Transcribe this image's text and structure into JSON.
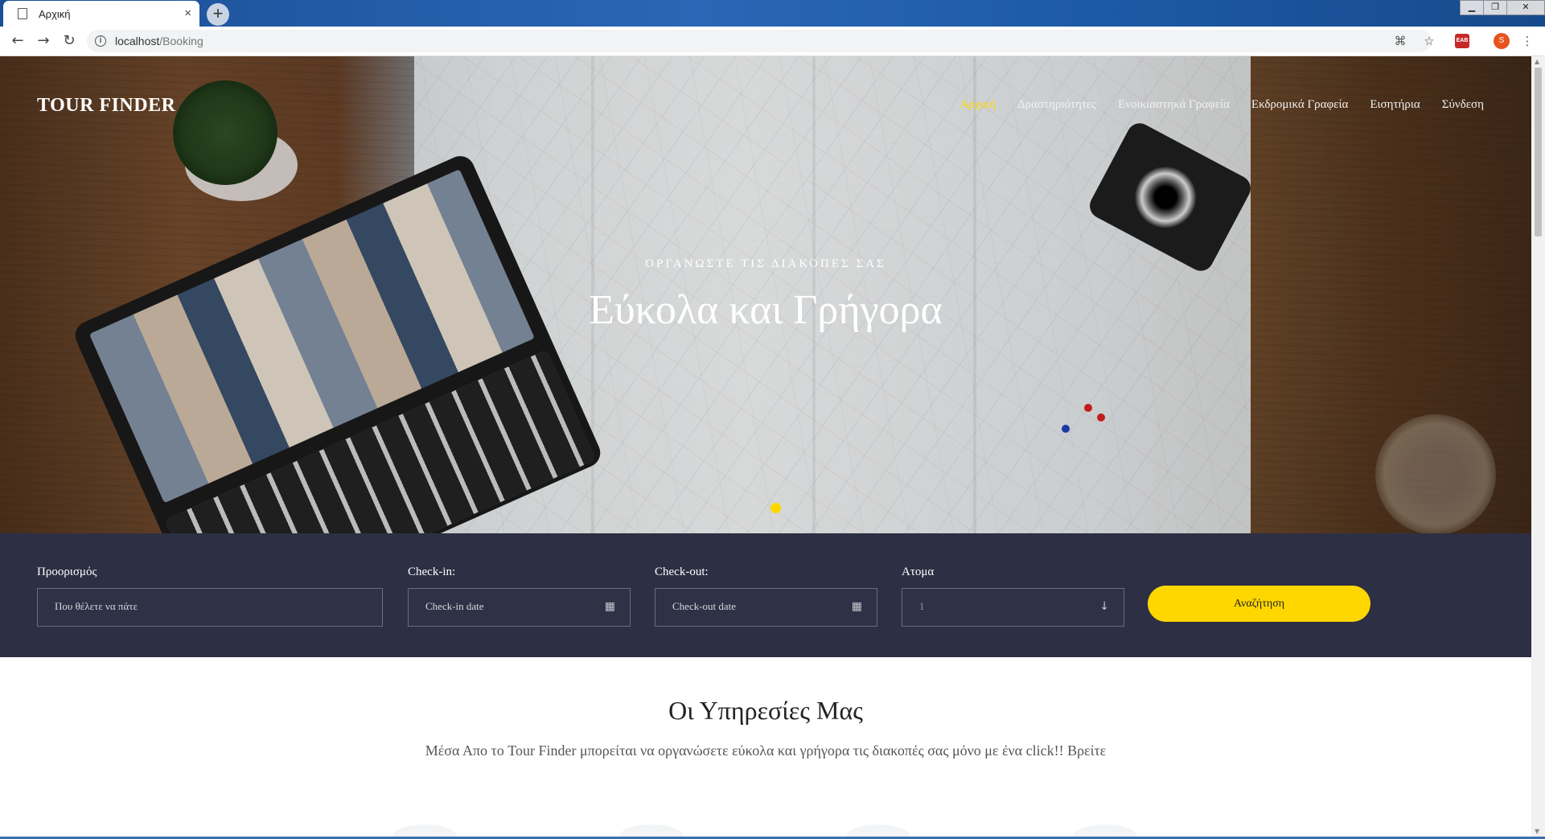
{
  "browser": {
    "tab_title": "Αρχική",
    "tab_close": "×",
    "new_tab": "+",
    "url_host": "localhost",
    "url_path": "/Booking",
    "win_min": "▁",
    "win_max": "❐",
    "win_close": "✕"
  },
  "site": {
    "brand": "TOUR FINDER",
    "nav": [
      {
        "label": "Αρχική",
        "active": true
      },
      {
        "label": "Δραστηριότητες"
      },
      {
        "label": "Ενοικιαστηκά Γραφεία"
      },
      {
        "label": "Εκδρομικά Γραφεία"
      },
      {
        "label": "Εισητήρια"
      },
      {
        "label": "Σύνδεση"
      }
    ],
    "accent_color": "#ffd700",
    "dark_color": "#2d2f44"
  },
  "hero": {
    "subtitle": "ΟΡΓΑΝΩΣΤΕ ΤΙΣ ΔΙΑΚΟΠΕΣ ΣΑΣ",
    "title": "Εύκολα και Γρήγορα"
  },
  "booking": {
    "destination_label": "Προορισμός",
    "destination_placeholder": "Που θέλετε να πάτε",
    "checkin_label": "Check-in:",
    "checkin_placeholder": "Check-in date",
    "checkout_label": "Check-out:",
    "checkout_placeholder": "Check-out date",
    "people_label": "Ατομα",
    "people_value": "1",
    "search_button": "Αναζήτηση"
  },
  "services": {
    "title": "Οι Υπηρεσίες Μας",
    "text": "Μέσα Απο το Tour Finder μπορείται να οργανώσετε εύκολα και γρήγορα τις διακοπές σας μόνο με ένα click!! Βρείτε"
  }
}
